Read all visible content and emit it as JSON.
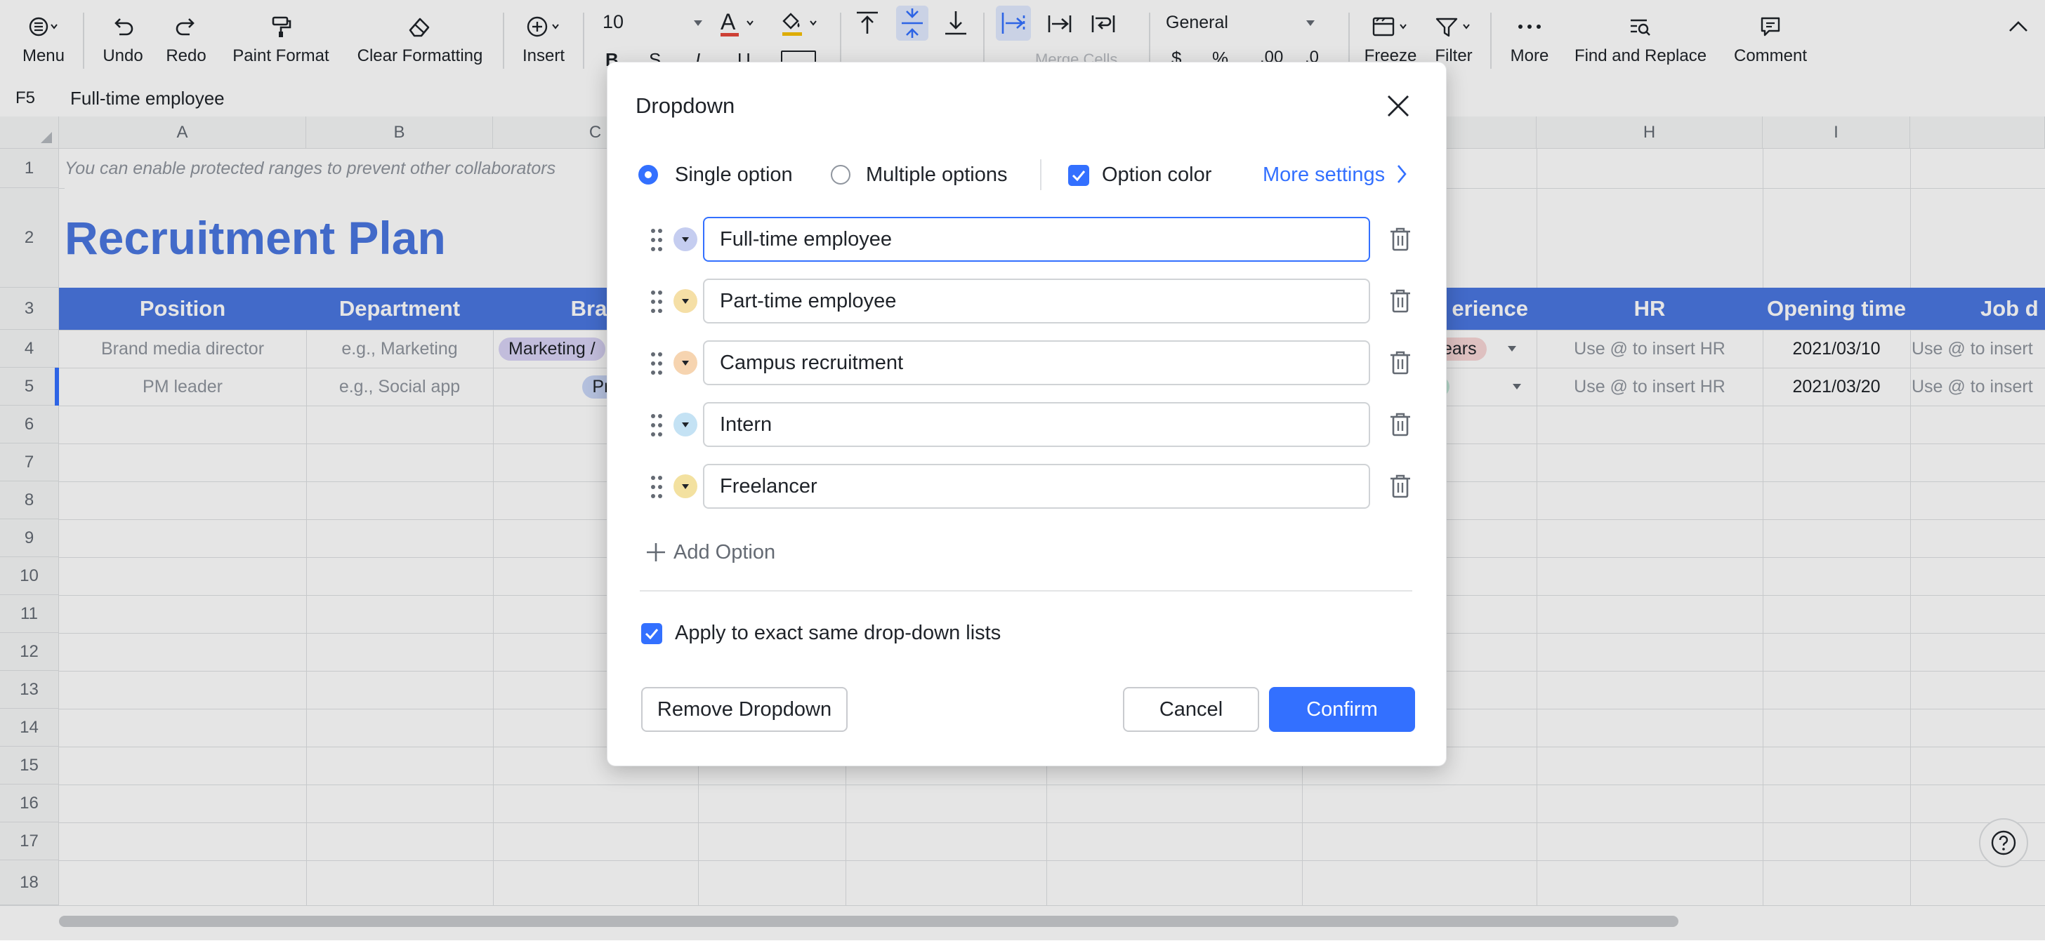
{
  "toolbar": {
    "menu_label": "Menu",
    "undo_label": "Undo",
    "redo_label": "Redo",
    "paint_format_label": "Paint Format",
    "clear_formatting_label": "Clear Formatting",
    "insert_label": "Insert",
    "font_size": "10",
    "number_format": "General",
    "merge_cells_label": "Merge Cells",
    "freeze_label": "Freeze",
    "filter_label": "Filter",
    "more_label": "More",
    "find_replace_label": "Find and Replace",
    "comment_label": "Comment",
    "icons": [
      "menu-icon",
      "undo-icon",
      "redo-icon",
      "paint-format-icon",
      "eraser-icon",
      "insert-icon",
      "font-color-icon",
      "fill-color-icon",
      "align-top-icon",
      "align-middle-icon",
      "align-bottom-icon",
      "freeze-icon",
      "filter-icon",
      "more-icon",
      "find-replace-icon",
      "comment-icon",
      "collapse-icon"
    ]
  },
  "formula_bar": {
    "cell_ref": "F5",
    "value": "Full-time employee"
  },
  "sheet": {
    "columns": [
      "A",
      "B",
      "C",
      "H",
      "I"
    ],
    "rows": [
      "1",
      "2",
      "3",
      "4",
      "5",
      "6",
      "7",
      "8",
      "9",
      "10",
      "11",
      "12",
      "13",
      "14",
      "15",
      "16",
      "17",
      "18"
    ],
    "hint": "You can enable protected ranges to prevent other collaborators",
    "title": "Recruitment Plan",
    "headers": [
      "Position",
      "Department",
      "Bran",
      "erience",
      "HR",
      "Opening time",
      "Job d"
    ],
    "row4": [
      "Brand media director",
      "e.g., Marketing",
      "Marketing /",
      "ears",
      "Use @ to insert HR",
      "2021/03/10",
      "Use @ to insert"
    ],
    "row5": [
      "PM leader",
      "e.g., Social app",
      "Produc",
      "",
      "Use @ to insert HR",
      "2021/03/20",
      "Use @ to insert"
    ],
    "header_color": "#4a76e0",
    "title_color": "#4a76e0"
  },
  "dialog": {
    "title": "Dropdown",
    "single_option_label": "Single option",
    "multiple_options_label": "Multiple options",
    "option_color_label": "Option color",
    "more_settings_label": "More settings",
    "selection_mode": "single",
    "option_color_checked": true,
    "options": [
      {
        "value": "Full-time employee",
        "color": "#c5cdf0",
        "focused": true
      },
      {
        "value": "Part-time employee",
        "color": "#f5dfa6"
      },
      {
        "value": "Campus recruitment",
        "color": "#f6d4b0"
      },
      {
        "value": "Intern",
        "color": "#c4e2f4"
      },
      {
        "value": "Freelancer",
        "color": "#f3e1a0"
      }
    ],
    "add_option_label": "Add Option",
    "apply_same_label": "Apply to exact same drop-down lists",
    "apply_same_checked": true,
    "remove_label": "Remove Dropdown",
    "cancel_label": "Cancel",
    "confirm_label": "Confirm",
    "accent_color": "#3370ff"
  }
}
